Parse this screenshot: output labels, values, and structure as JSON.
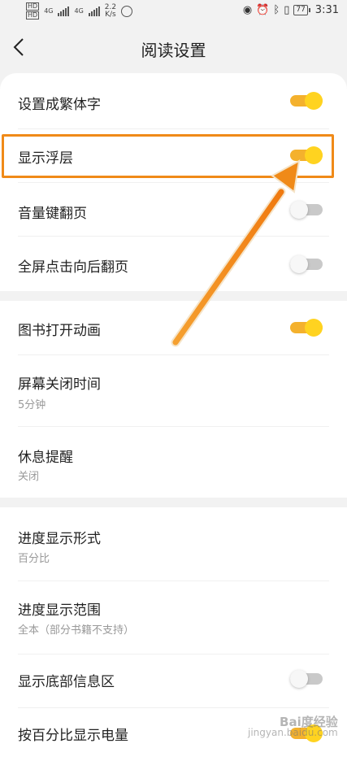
{
  "status_bar": {
    "sim1": "HD",
    "sim2": "HD",
    "net1": "4G",
    "net2": "4G",
    "speed_value": "2.2",
    "speed_unit": "K/s",
    "battery": "77",
    "time": "3:31"
  },
  "header": {
    "title": "阅读设置"
  },
  "sections": {
    "s1": {
      "items": [
        {
          "label": "设置成繁体字",
          "toggle": "on"
        },
        {
          "label": "显示浮层",
          "toggle": "on"
        },
        {
          "label": "音量键翻页",
          "toggle": "off"
        },
        {
          "label": "全屏点击向后翻页",
          "toggle": "off"
        }
      ]
    },
    "s2": {
      "items": [
        {
          "label": "图书打开动画",
          "toggle": "on"
        },
        {
          "label": "屏幕关闭时间",
          "value": "5分钟"
        },
        {
          "label": "休息提醒",
          "value": "关闭"
        }
      ]
    },
    "s3": {
      "items": [
        {
          "label": "进度显示形式",
          "value": "百分比"
        },
        {
          "label": "进度显示范围",
          "value": "全本（部分书籍不支持）"
        },
        {
          "label": "显示底部信息区",
          "toggle": "off"
        },
        {
          "label": "按百分比显示电量",
          "toggle": "on"
        }
      ]
    }
  },
  "watermark": {
    "main": "Bai度经验",
    "url": "jingyan.baidu.com"
  },
  "colors": {
    "toggle_on": "#f4b12d",
    "knob_on": "#ffd320",
    "toggle_off": "#c9c9c9",
    "annotation": "#f08a18"
  }
}
